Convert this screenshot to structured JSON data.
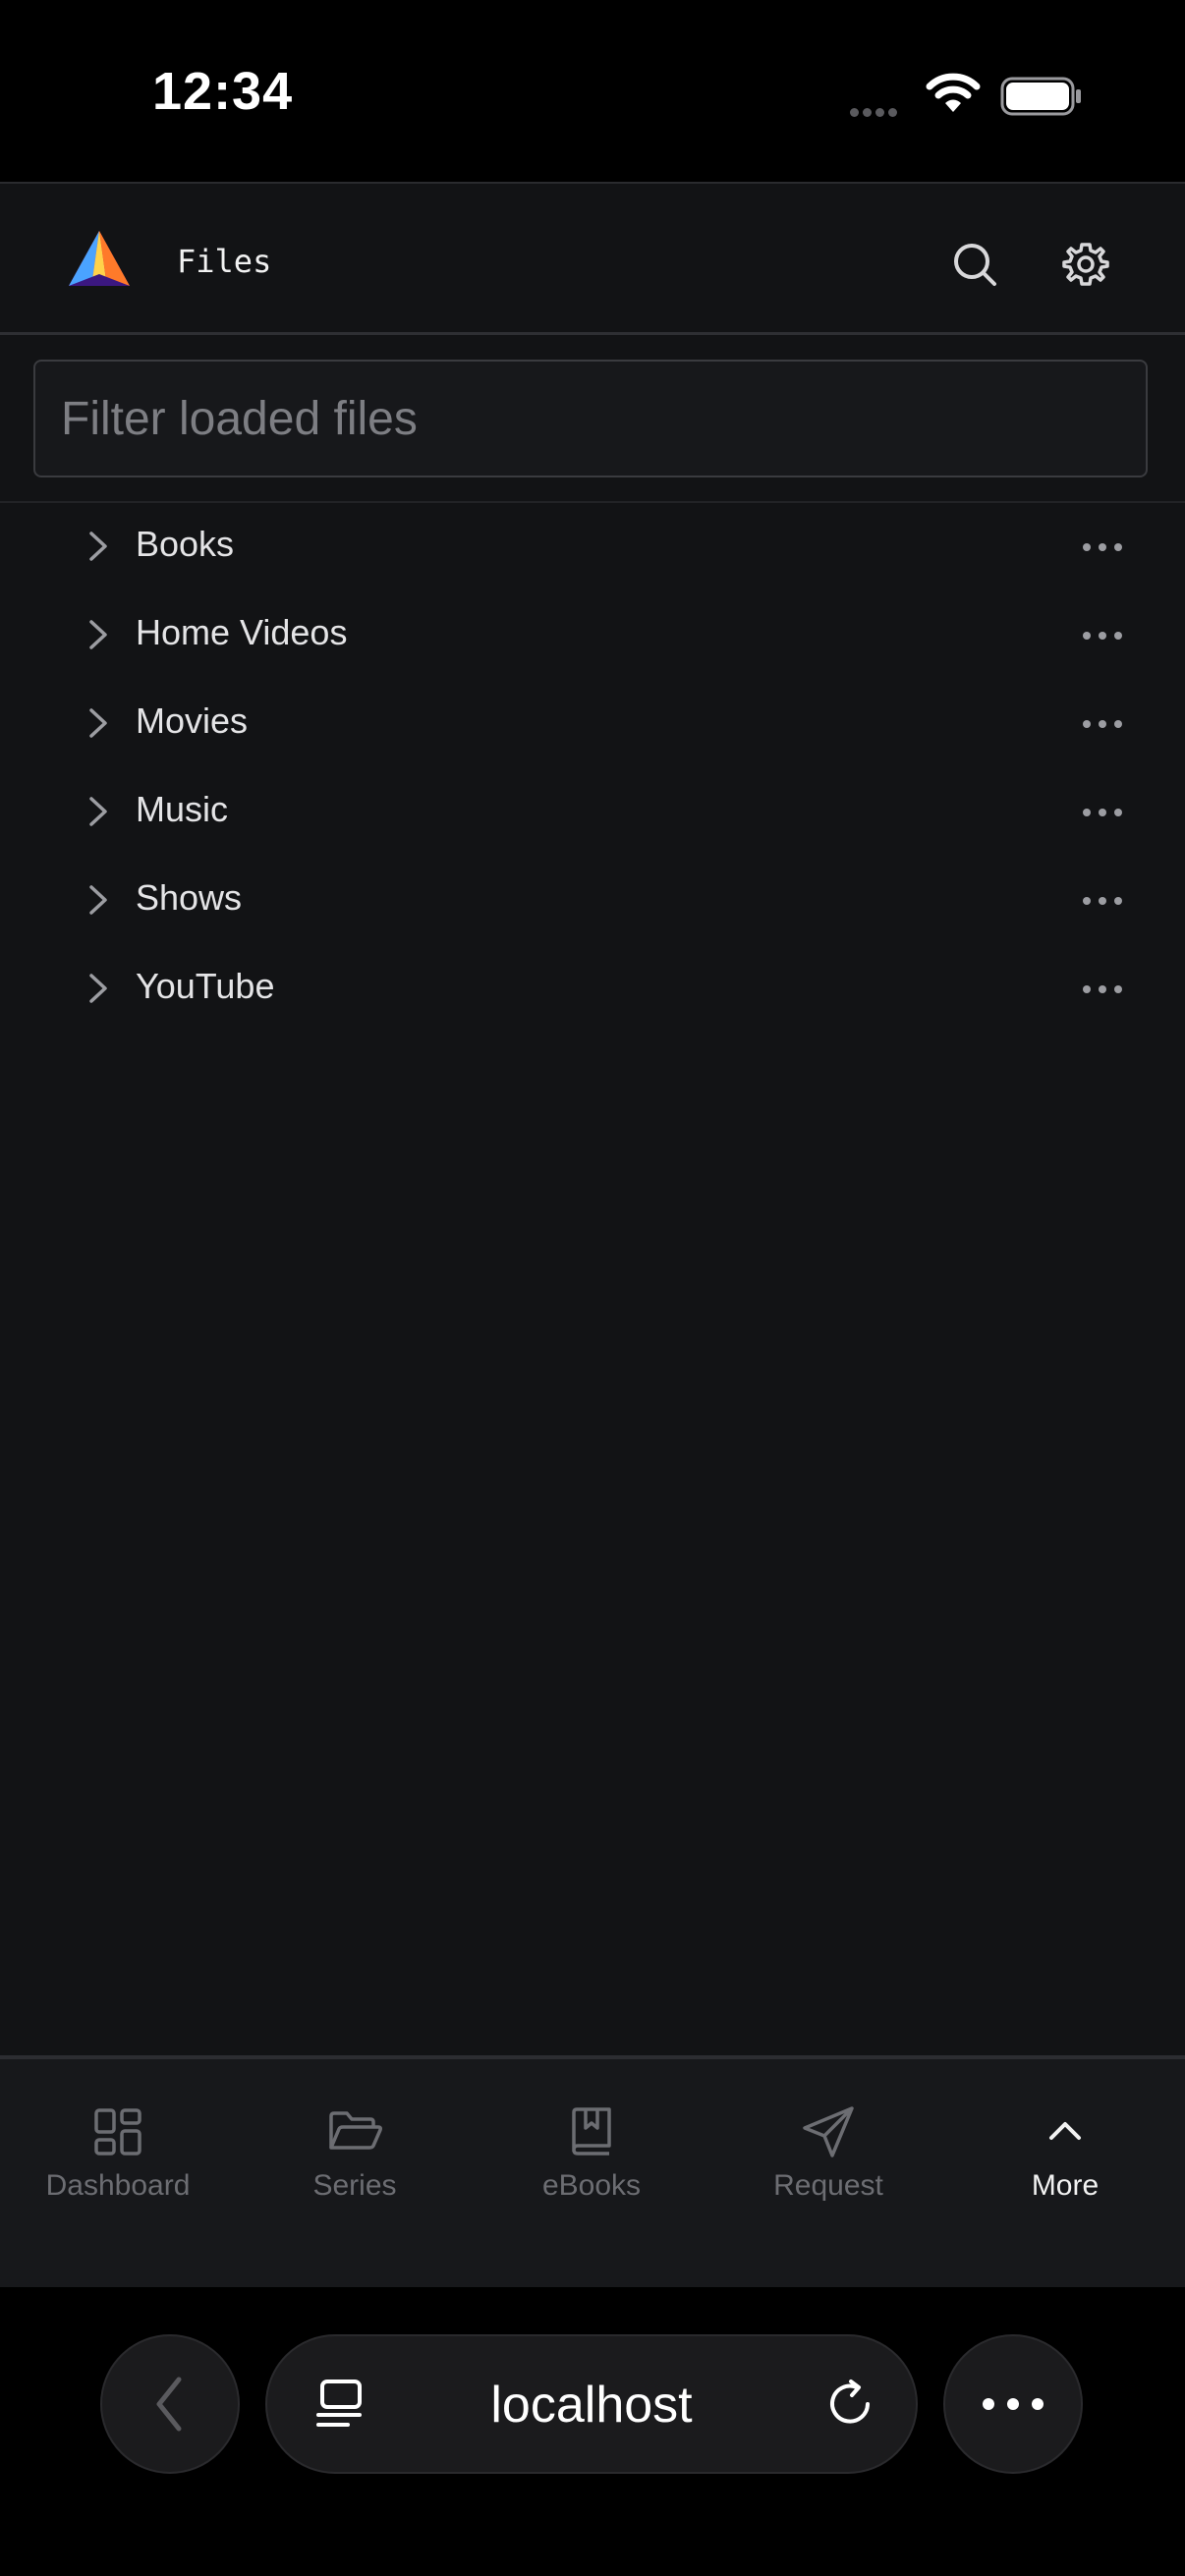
{
  "status": {
    "time": "12:34"
  },
  "header": {
    "title": "Files",
    "search_icon": "search-icon",
    "settings_icon": "gear-icon"
  },
  "filter": {
    "placeholder": "Filter loaded files",
    "value": ""
  },
  "tree": {
    "items": [
      {
        "label": "Books"
      },
      {
        "label": "Home Videos"
      },
      {
        "label": "Movies"
      },
      {
        "label": "Music"
      },
      {
        "label": "Shows"
      },
      {
        "label": "YouTube"
      }
    ]
  },
  "nav": {
    "items": [
      {
        "label": "Dashboard",
        "icon": "dashboard-icon"
      },
      {
        "label": "Series",
        "icon": "folder-open-icon"
      },
      {
        "label": "eBooks",
        "icon": "book-icon"
      },
      {
        "label": "Request",
        "icon": "send-icon"
      },
      {
        "label": "More",
        "icon": "chevron-up-icon",
        "active": true
      }
    ]
  },
  "browser": {
    "url": "localhost"
  },
  "colors": {
    "background": "#121315",
    "status_bar": "#000000",
    "nav_inactive": "#6c6d72",
    "nav_active": "#f2f2f2"
  }
}
